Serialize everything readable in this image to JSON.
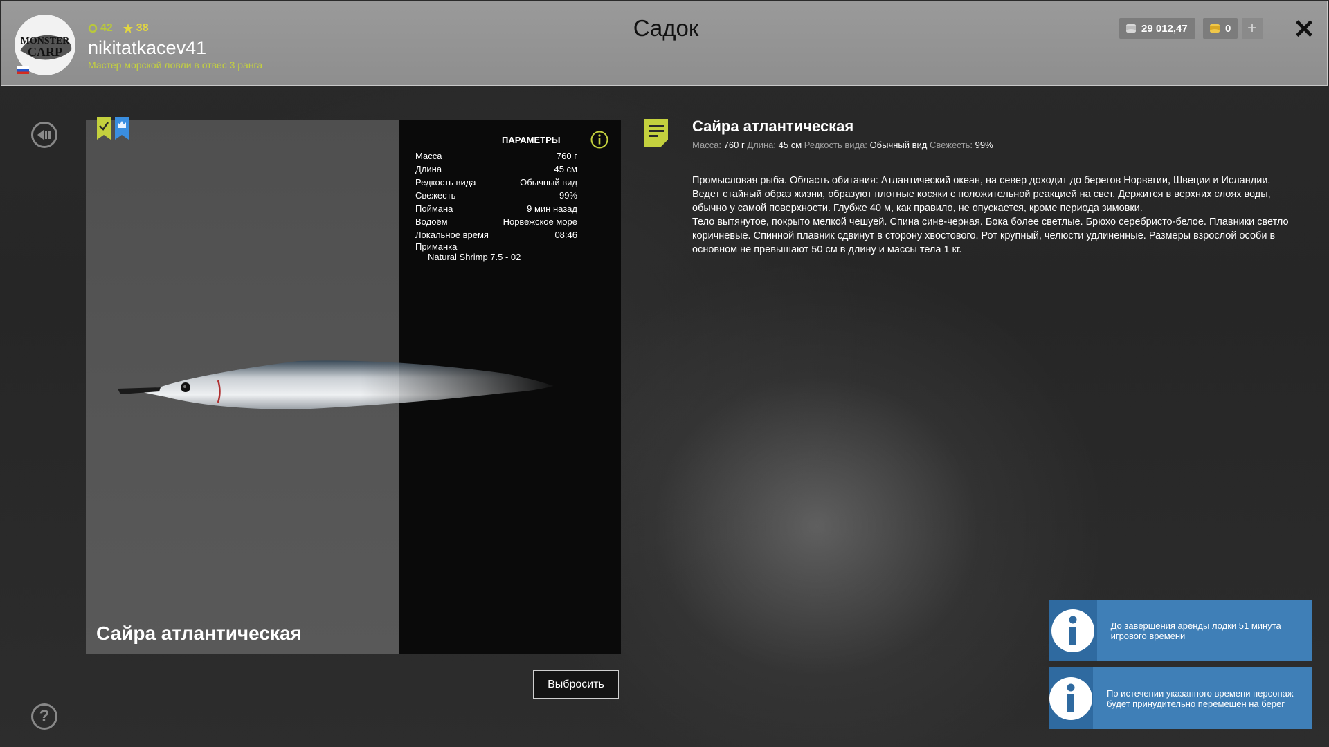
{
  "header": {
    "title": "Садок",
    "player": {
      "level": "42",
      "stars": "38",
      "username": "nikitatkacev41",
      "rank": "Мастер морской ловли в отвес 3 ранга",
      "avatar_text": "MONSTER CARP"
    },
    "currency": {
      "silver": "29 012,47",
      "gold": "0"
    }
  },
  "fish": {
    "name": "Сайра атлантическая",
    "params_title": "ПАРАМЕТРЫ",
    "params": [
      {
        "label": "Масса",
        "value": "760 г"
      },
      {
        "label": "Длина",
        "value": "45 см"
      },
      {
        "label": "Редкость вида",
        "value": "Обычный вид"
      },
      {
        "label": "Свежесть",
        "value": "99%"
      },
      {
        "label": "Поймана",
        "value": "9 мин назад"
      },
      {
        "label": "Водоём",
        "value": "Норвежское море"
      },
      {
        "label": "Локальное время",
        "value": "08:46"
      }
    ],
    "bait_label": "Приманка",
    "bait_value": "Natural Shrimp 7.5 - 02",
    "discard_label": "Выбросить"
  },
  "description": {
    "title": "Сайра атлантическая",
    "meta": [
      {
        "label": "Масса:",
        "value": "760 г"
      },
      {
        "label": "Длина:",
        "value": "45 см"
      },
      {
        "label": "Редкость вида:",
        "value": "Обычный вид"
      },
      {
        "label": "Свежесть:",
        "value": "99%"
      }
    ],
    "paragraphs": [
      "Промысловая рыба. Область обитания: Атлантический океан, на север доходит до берегов Норвегии, Швеции и Исландии. Ведет стайный образ жизни, образуют плотные косяки с положительной реакцией на свет. Держится в верхних слоях воды, обычно у самой поверхности. Глубже 40 м, как правило, не опускается, кроме периода зимовки.",
      "Тело вытянутое, покрыто мелкой чешуей. Спина сине-черная. Бока более светлые. Брюхо серебристо-белое. Плавники светло коричневые. Спинной плавник сдвинут в сторону хвостового. Рот крупный, челюсти удлиненные. Размеры взрослой особи в основном не превышают 50 см в длину и массы тела 1 кг."
    ]
  },
  "notifications": [
    {
      "text": "До завершения аренды лодки 51 минута игрового времени"
    },
    {
      "text": "По истечении указанного времени персонаж будет принудительно перемещен на берег"
    }
  ],
  "colors": {
    "accent_green": "#c4d13e",
    "notification_blue": "#3f7fb7",
    "badge_blue": "#3a8ee0"
  }
}
